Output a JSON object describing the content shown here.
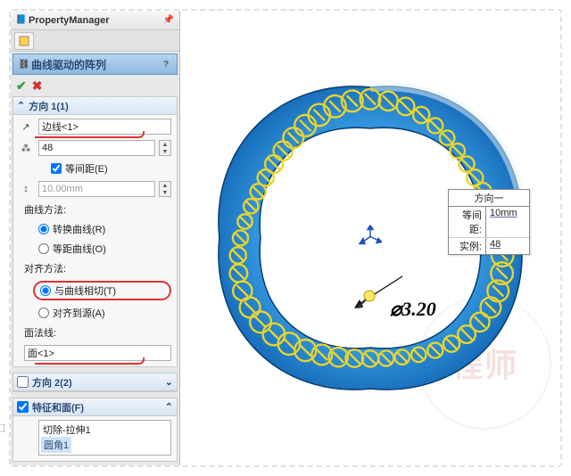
{
  "pm": {
    "title": "PropertyManager",
    "feature_name": "曲线驱动的阵列",
    "pin_icon": "📌",
    "help_icon": "?",
    "ok_icon": "✔",
    "cancel_icon": "✖"
  },
  "dir1": {
    "header": "方向 1(1)",
    "edge_value": "边线<1>",
    "count_value": "48",
    "equal_spacing_label": "等间距(E)",
    "equal_spacing_checked": true,
    "spacing_value": "10.00mm",
    "curve_method_label": "曲线方法:",
    "curve_method_options": [
      {
        "label": "转换曲线(R)",
        "checked": true
      },
      {
        "label": "等距曲线(O)",
        "checked": false
      }
    ],
    "align_method_label": "对齐方法:",
    "align_method_options": [
      {
        "label": "与曲线相切(T)",
        "checked": true,
        "highlighted": true
      },
      {
        "label": "对齐到源(A)",
        "checked": false
      }
    ],
    "face_normal_label": "面法线:",
    "face_value": "面<1>"
  },
  "dir2": {
    "header": "方向 2(2)",
    "checked": false
  },
  "features_panel": {
    "header": "特征和面(F)",
    "checked": true,
    "items": [
      "切除-拉伸1",
      "圆角1"
    ]
  },
  "viewport": {
    "callout_title": "方向一",
    "callout_rows": [
      {
        "k": "等间距:",
        "v": "10mm"
      },
      {
        "k": "实例:",
        "v": "48"
      }
    ],
    "dimension": "⌀3.20",
    "watermark": "程师"
  }
}
